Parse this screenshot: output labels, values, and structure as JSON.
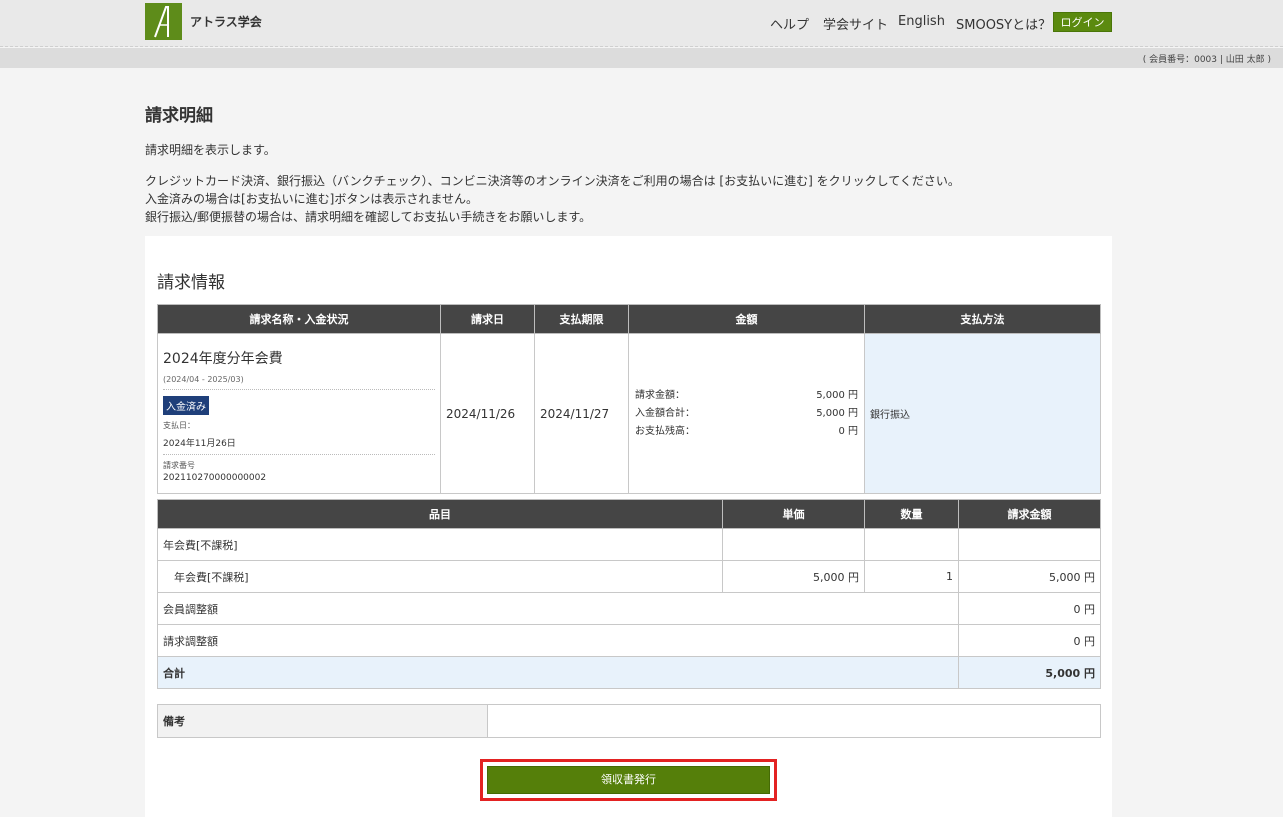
{
  "header": {
    "site_name": "アトラス学会",
    "nav": [
      "ヘルプ",
      "学会サイト",
      "English",
      "SMOOSYとは？"
    ],
    "login_label": "ログイン",
    "member_info": "( 会員番号：0003 | 山田 太郎 )",
    "brand_color": "#5b8a0f"
  },
  "page": {
    "title": "請求明細",
    "desc1": "請求明細を表示します。",
    "desc2": "クレジットカード決済、銀行振込（バンクチェック）、コンビニ決済等のオンライン決済をご利用の場合は [お支払いに進む] をクリックしてください。",
    "desc3": "入金済みの場合は[お支払いに進む]ボタンは表示されません。",
    "desc4": "銀行振込/郵便振替の場合は、請求明細を確認してお支払い手続きをお願いします。"
  },
  "invoice": {
    "section_title": "請求情報",
    "headers": [
      "請求名称・入金状況",
      "請求日",
      "支払期限",
      "金額",
      "支払方法"
    ],
    "name": "2024年度分年会費",
    "period": "(2024/04 - 2025/03)",
    "status_badge": "入金済み",
    "paid_date_label": "支払日：",
    "paid_date": "2024年11月26日",
    "number_label": "請求番号",
    "number": "202110270000000002",
    "billing_date": "2024/11/26",
    "due_date": "2024/11/27",
    "amount_rows": [
      {
        "label": "請求金額：",
        "value": "5,000 円"
      },
      {
        "label": "入金額合計：",
        "value": "5,000 円"
      },
      {
        "label": "お支払残高：",
        "value": "0 円"
      }
    ],
    "payment_method": "銀行振込"
  },
  "items": {
    "headers": [
      "品目",
      "単価",
      "数量",
      "請求金額"
    ],
    "group": "年会費[不課税]",
    "row": {
      "name": "年会費[不課税]",
      "unit_price": "5,000 円",
      "qty": "1",
      "amount": "5,000 円"
    },
    "member_adjust": {
      "label": "会員調整額",
      "value": "0 円"
    },
    "invoice_adjust": {
      "label": "請求調整額",
      "value": "0 円"
    },
    "total": {
      "label": "合計",
      "value": "5,000 円"
    }
  },
  "remarks": {
    "label": "備考",
    "value": ""
  },
  "receipt_button": "領収書発行"
}
